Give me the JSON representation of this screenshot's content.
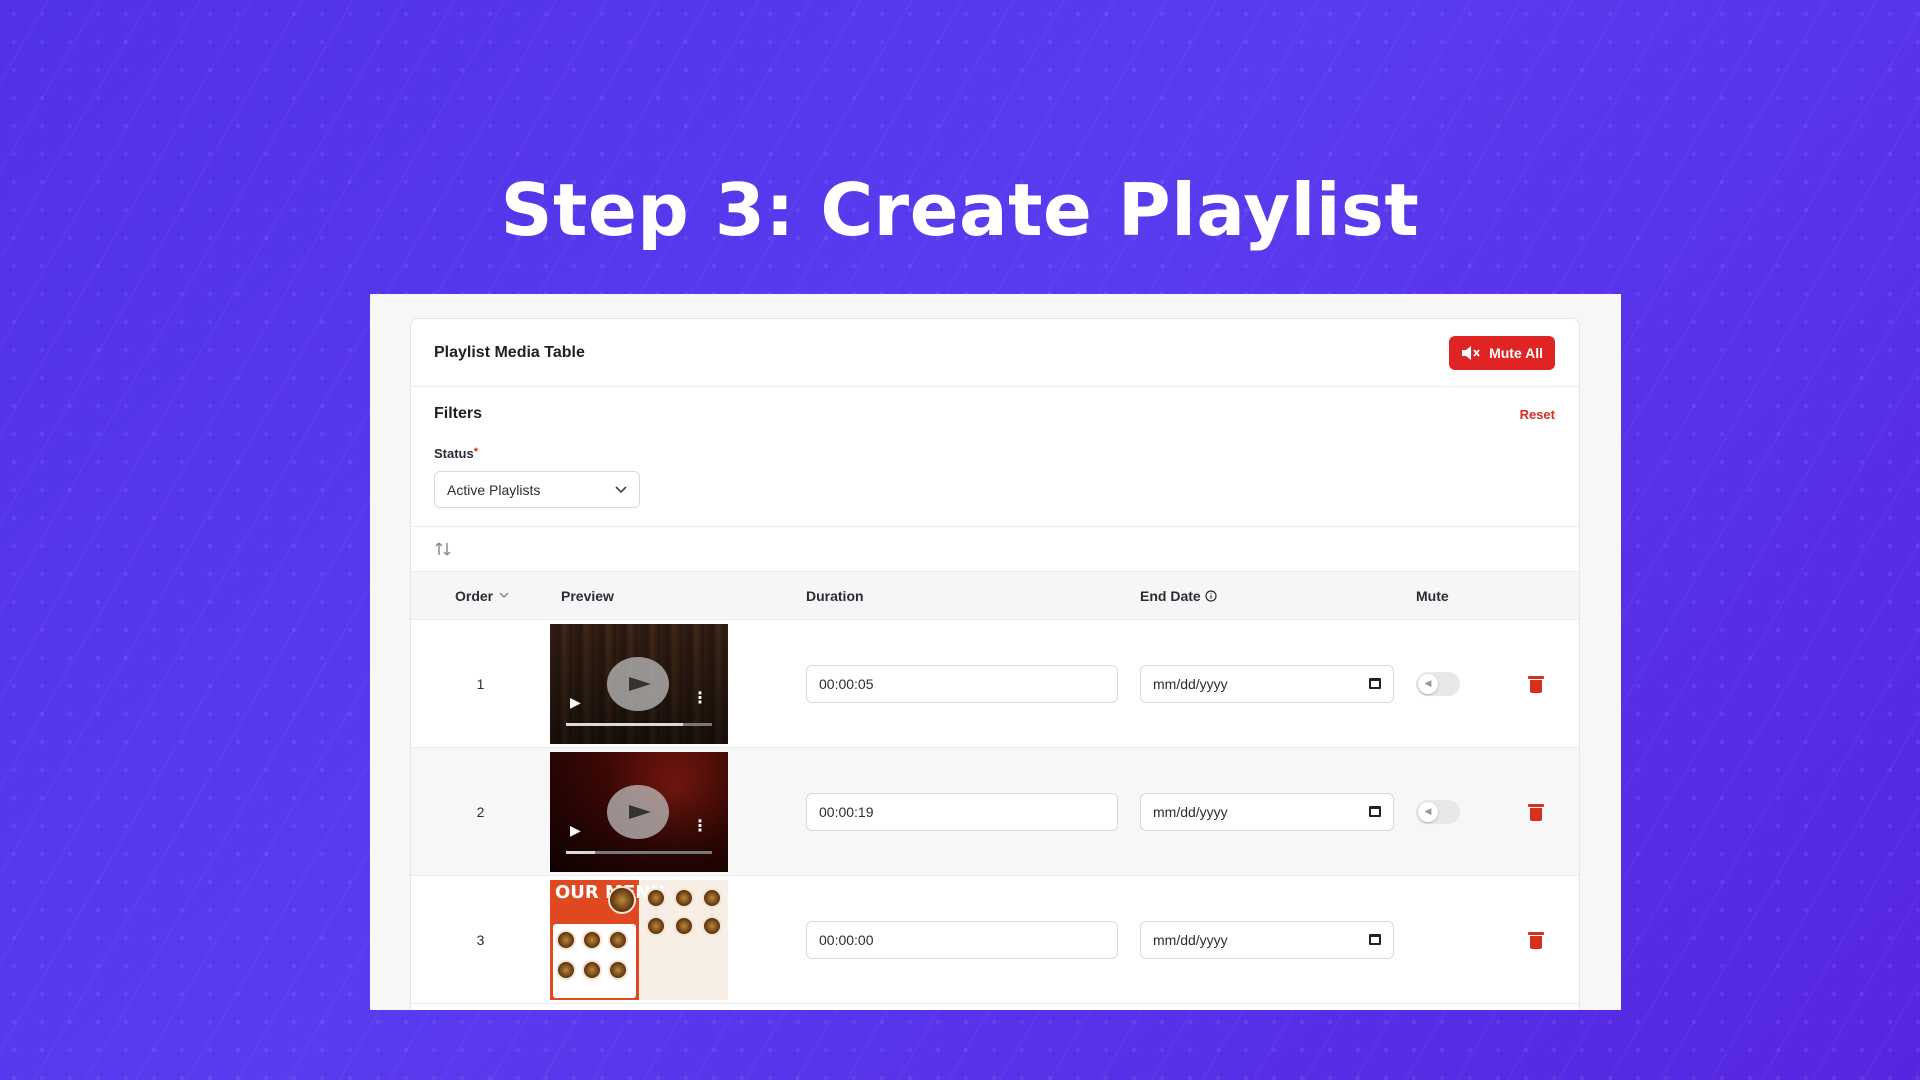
{
  "hero": {
    "title": "Step 3: Create Playlist"
  },
  "card": {
    "title": "Playlist Media Table",
    "mute_all_label": "Mute All"
  },
  "filters": {
    "title": "Filters",
    "reset_label": "Reset",
    "status_label": "Status",
    "status_required_mark": "*",
    "status_value": "Active Playlists"
  },
  "table": {
    "columns": {
      "order": "Order",
      "preview": "Preview",
      "duration": "Duration",
      "end_date": "End Date",
      "mute": "Mute"
    },
    "rows": [
      {
        "order": "1",
        "preview_type": "video",
        "duration": "00:00:05",
        "end_date_placeholder": "mm/dd/yyyy",
        "mute_toggle": true,
        "mute_on": false,
        "video_progress": 0.8
      },
      {
        "order": "2",
        "preview_type": "video",
        "duration": "00:00:19",
        "end_date_placeholder": "mm/dd/yyyy",
        "mute_toggle": true,
        "mute_on": false,
        "video_progress": 0.2
      },
      {
        "order": "3",
        "preview_type": "image",
        "menu_title": "OUR MENU",
        "duration": "00:00:00",
        "end_date_placeholder": "mm/dd/yyyy",
        "mute_toggle": false
      }
    ]
  },
  "colors": {
    "accent_red": "#e02424",
    "background_purple": "#5231e6"
  }
}
